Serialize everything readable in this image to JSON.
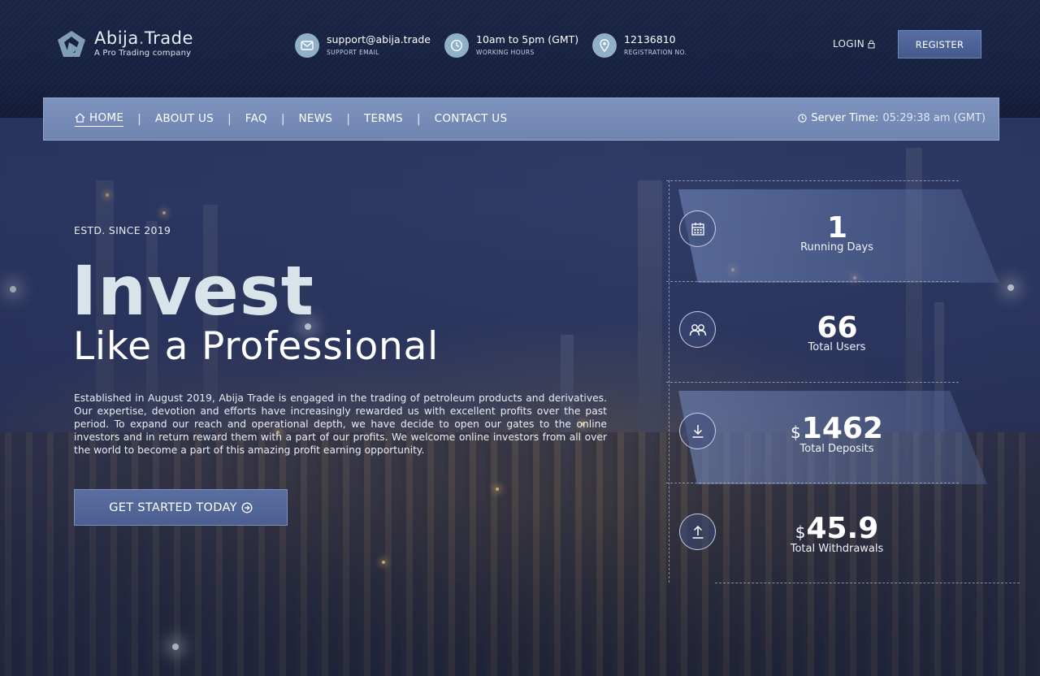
{
  "brand": {
    "name_left": "Abija",
    "name_dot": ".",
    "name_right": "Trade",
    "tagline": "A Pro Trading company"
  },
  "header": {
    "email": {
      "value": "support@abija.trade",
      "label": "SUPPORT EMAIL",
      "icon": "mail-icon"
    },
    "hours": {
      "value": "10am to 5pm (GMT)",
      "label": "WORKING HOURS",
      "icon": "clock-icon"
    },
    "registration": {
      "value": "12136810",
      "label": "REGISTRATION NO.",
      "icon": "location-pin-icon"
    },
    "login_label": "LOGIN",
    "register_label": "REGISTER"
  },
  "nav": {
    "items": [
      {
        "label": "HOME",
        "active": true
      },
      {
        "label": "ABOUT US"
      },
      {
        "label": "FAQ"
      },
      {
        "label": "NEWS"
      },
      {
        "label": "TERMS"
      },
      {
        "label": "CONTACT US"
      }
    ],
    "separator": "|",
    "server_time_label": "Server Time:",
    "server_time_value": "05:29:38 am (GMT)"
  },
  "hero": {
    "estd": "ESTD. SINCE 2019",
    "title_big": "Invest",
    "title_sub": "Like a Professional",
    "description": "Established in August 2019, Abija Trade is engaged in the trading of petroleum products and derivatives. Our expertise, devotion and efforts have increasingly rewarded us with excellent profits over the past period. To expand our reach and operational depth, we have decide to open our gates to the online investors and in return reward them with a part of our profits. We welcome online investors from all over the world to become a part of this amazing profit earning opportunity.",
    "cta_label": "GET STARTED TODAY"
  },
  "stats": [
    {
      "value": "1",
      "currency": "",
      "label": "Running Days",
      "icon": "calendar-icon"
    },
    {
      "value": "66",
      "currency": "",
      "label": "Total Users",
      "icon": "users-icon"
    },
    {
      "value": "1462",
      "currency": "$",
      "label": "Total Deposits",
      "icon": "download-icon"
    },
    {
      "value": "45.9",
      "currency": "$",
      "label": "Total Withdrawals",
      "icon": "upload-icon"
    }
  ],
  "colors": {
    "header_bg": "#162040",
    "nav_bg": "#7489b5",
    "accent": "#8fb0c7",
    "button": "#4c5f90"
  }
}
